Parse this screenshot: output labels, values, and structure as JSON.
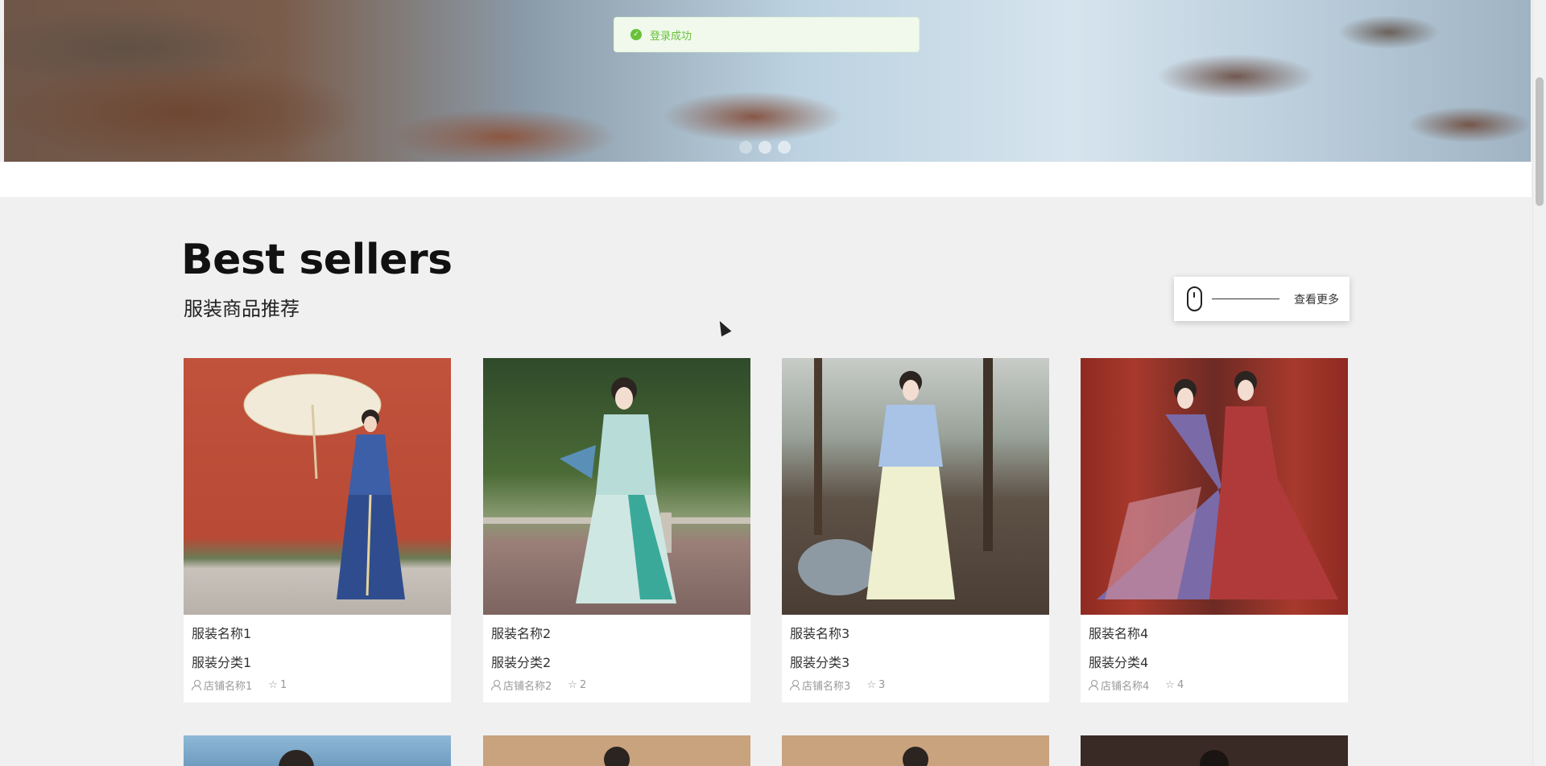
{
  "toast": {
    "message": "登录成功",
    "icon": "check-circle-icon",
    "color": "#67c23a"
  },
  "banner": {
    "dots": 3,
    "active_dot": 0
  },
  "section": {
    "title": "Best sellers",
    "subtitle": "服装商品推荐",
    "more_label": "查看更多"
  },
  "products": [
    {
      "name": "服装名称1",
      "category": "服装分类1",
      "shop": "店铺名称1",
      "rating": "1"
    },
    {
      "name": "服装名称2",
      "category": "服装分类2",
      "shop": "店铺名称2",
      "rating": "2"
    },
    {
      "name": "服装名称3",
      "category": "服装分类3",
      "shop": "店铺名称3",
      "rating": "3"
    },
    {
      "name": "服装名称4",
      "category": "服装分类4",
      "shop": "店铺名称4",
      "rating": "4"
    }
  ],
  "colors": {
    "accent_success": "#67c23a",
    "page_bg": "#f0f0f0"
  }
}
